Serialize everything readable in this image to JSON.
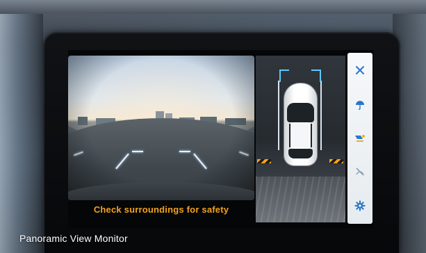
{
  "camera": {
    "safety_message": "Check surroundings for safety"
  },
  "sidebar": {
    "icons": [
      {
        "name": "close-icon",
        "symbol": "×"
      },
      {
        "name": "umbrella-icon"
      },
      {
        "name": "camera-view-icon"
      },
      {
        "name": "sensor-off-icon"
      },
      {
        "name": "gear-icon"
      }
    ]
  },
  "caption": {
    "text": "Panoramic View Monitor"
  },
  "colors": {
    "accent": "#f3a21d",
    "guide": "#5ec8ff",
    "icon_blue": "#2a78c8"
  }
}
